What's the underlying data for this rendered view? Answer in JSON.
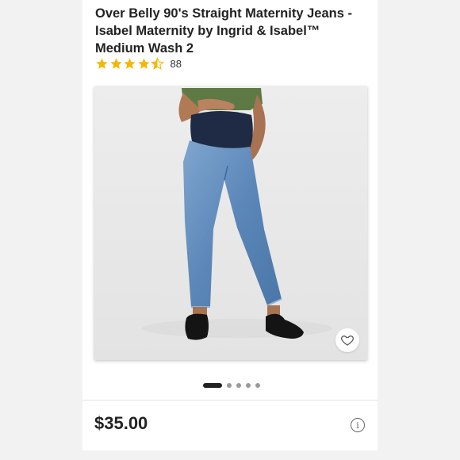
{
  "product": {
    "title_line1": "Over Belly 90's Straight Maternity Jeans -",
    "title_line2": "Isabel Maternity by Ingrid & Isabel™",
    "title_line3": "Medium Wash 2",
    "rating_value": 4.5,
    "rating_count": "88",
    "price": "$35.00"
  },
  "gallery": {
    "image_subject": "model wearing blue maternity jeans with green top and black loafers",
    "page_count": 5,
    "active_index": 0
  },
  "icons": {
    "star": "star-icon",
    "favorite": "heart-icon",
    "info": "info-icon"
  },
  "colors": {
    "star": "#f5b800",
    "text": "#222222",
    "card": "#ffffff",
    "background": "#f2f2f2"
  }
}
